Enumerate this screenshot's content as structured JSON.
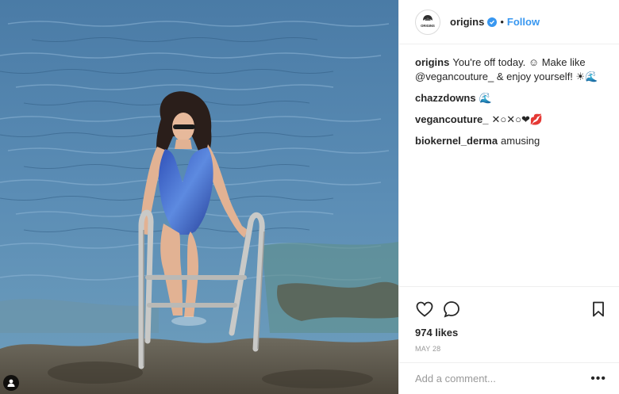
{
  "header": {
    "username": "origins",
    "separator": "•",
    "follow_label": "Follow",
    "avatar_text": "ORIGINS"
  },
  "caption": {
    "username": "origins",
    "text": "You're off today. ☺ Make like @vegancouture_ & enjoy yourself! ☀🌊"
  },
  "comments": [
    {
      "username": "chazzdowns",
      "text": "🌊"
    },
    {
      "username": "vegancouture_",
      "text": "✕○✕○❤💋"
    },
    {
      "username": "biokernel_derma",
      "text": "amusing"
    }
  ],
  "likes": "974 likes",
  "date": "MAY 28",
  "add_comment": {
    "placeholder": "Add a comment...",
    "more": "•••"
  },
  "icons": {
    "like": "heart-icon",
    "comment": "comment-icon",
    "save": "bookmark-icon",
    "tag": "user-tag-icon",
    "verified": "verified-badge-icon"
  },
  "colors": {
    "accent": "#3897f0",
    "muted": "#999999",
    "text": "#262626"
  }
}
